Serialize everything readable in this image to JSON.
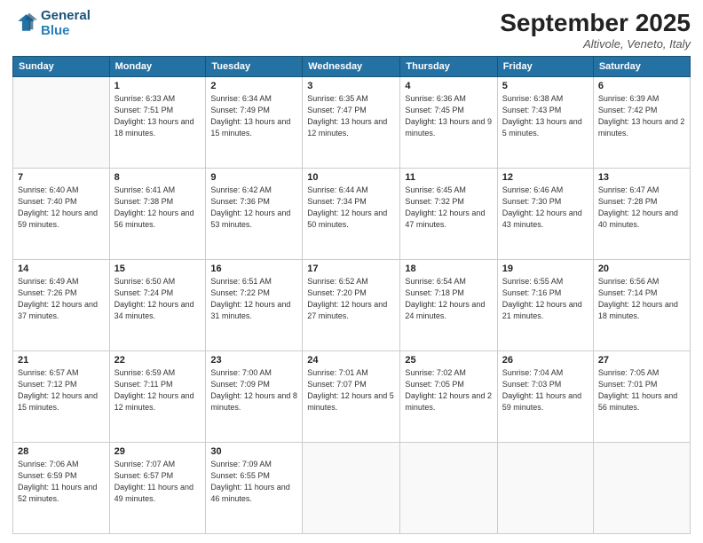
{
  "header": {
    "logo_line1": "General",
    "logo_line2": "Blue",
    "month_title": "September 2025",
    "location": "Altivole, Veneto, Italy"
  },
  "days_of_week": [
    "Sunday",
    "Monday",
    "Tuesday",
    "Wednesday",
    "Thursday",
    "Friday",
    "Saturday"
  ],
  "weeks": [
    [
      {
        "day": "",
        "sunrise": "",
        "sunset": "",
        "daylight": ""
      },
      {
        "day": "1",
        "sunrise": "Sunrise: 6:33 AM",
        "sunset": "Sunset: 7:51 PM",
        "daylight": "Daylight: 13 hours and 18 minutes."
      },
      {
        "day": "2",
        "sunrise": "Sunrise: 6:34 AM",
        "sunset": "Sunset: 7:49 PM",
        "daylight": "Daylight: 13 hours and 15 minutes."
      },
      {
        "day": "3",
        "sunrise": "Sunrise: 6:35 AM",
        "sunset": "Sunset: 7:47 PM",
        "daylight": "Daylight: 13 hours and 12 minutes."
      },
      {
        "day": "4",
        "sunrise": "Sunrise: 6:36 AM",
        "sunset": "Sunset: 7:45 PM",
        "daylight": "Daylight: 13 hours and 9 minutes."
      },
      {
        "day": "5",
        "sunrise": "Sunrise: 6:38 AM",
        "sunset": "Sunset: 7:43 PM",
        "daylight": "Daylight: 13 hours and 5 minutes."
      },
      {
        "day": "6",
        "sunrise": "Sunrise: 6:39 AM",
        "sunset": "Sunset: 7:42 PM",
        "daylight": "Daylight: 13 hours and 2 minutes."
      }
    ],
    [
      {
        "day": "7",
        "sunrise": "Sunrise: 6:40 AM",
        "sunset": "Sunset: 7:40 PM",
        "daylight": "Daylight: 12 hours and 59 minutes."
      },
      {
        "day": "8",
        "sunrise": "Sunrise: 6:41 AM",
        "sunset": "Sunset: 7:38 PM",
        "daylight": "Daylight: 12 hours and 56 minutes."
      },
      {
        "day": "9",
        "sunrise": "Sunrise: 6:42 AM",
        "sunset": "Sunset: 7:36 PM",
        "daylight": "Daylight: 12 hours and 53 minutes."
      },
      {
        "day": "10",
        "sunrise": "Sunrise: 6:44 AM",
        "sunset": "Sunset: 7:34 PM",
        "daylight": "Daylight: 12 hours and 50 minutes."
      },
      {
        "day": "11",
        "sunrise": "Sunrise: 6:45 AM",
        "sunset": "Sunset: 7:32 PM",
        "daylight": "Daylight: 12 hours and 47 minutes."
      },
      {
        "day": "12",
        "sunrise": "Sunrise: 6:46 AM",
        "sunset": "Sunset: 7:30 PM",
        "daylight": "Daylight: 12 hours and 43 minutes."
      },
      {
        "day": "13",
        "sunrise": "Sunrise: 6:47 AM",
        "sunset": "Sunset: 7:28 PM",
        "daylight": "Daylight: 12 hours and 40 minutes."
      }
    ],
    [
      {
        "day": "14",
        "sunrise": "Sunrise: 6:49 AM",
        "sunset": "Sunset: 7:26 PM",
        "daylight": "Daylight: 12 hours and 37 minutes."
      },
      {
        "day": "15",
        "sunrise": "Sunrise: 6:50 AM",
        "sunset": "Sunset: 7:24 PM",
        "daylight": "Daylight: 12 hours and 34 minutes."
      },
      {
        "day": "16",
        "sunrise": "Sunrise: 6:51 AM",
        "sunset": "Sunset: 7:22 PM",
        "daylight": "Daylight: 12 hours and 31 minutes."
      },
      {
        "day": "17",
        "sunrise": "Sunrise: 6:52 AM",
        "sunset": "Sunset: 7:20 PM",
        "daylight": "Daylight: 12 hours and 27 minutes."
      },
      {
        "day": "18",
        "sunrise": "Sunrise: 6:54 AM",
        "sunset": "Sunset: 7:18 PM",
        "daylight": "Daylight: 12 hours and 24 minutes."
      },
      {
        "day": "19",
        "sunrise": "Sunrise: 6:55 AM",
        "sunset": "Sunset: 7:16 PM",
        "daylight": "Daylight: 12 hours and 21 minutes."
      },
      {
        "day": "20",
        "sunrise": "Sunrise: 6:56 AM",
        "sunset": "Sunset: 7:14 PM",
        "daylight": "Daylight: 12 hours and 18 minutes."
      }
    ],
    [
      {
        "day": "21",
        "sunrise": "Sunrise: 6:57 AM",
        "sunset": "Sunset: 7:12 PM",
        "daylight": "Daylight: 12 hours and 15 minutes."
      },
      {
        "day": "22",
        "sunrise": "Sunrise: 6:59 AM",
        "sunset": "Sunset: 7:11 PM",
        "daylight": "Daylight: 12 hours and 12 minutes."
      },
      {
        "day": "23",
        "sunrise": "Sunrise: 7:00 AM",
        "sunset": "Sunset: 7:09 PM",
        "daylight": "Daylight: 12 hours and 8 minutes."
      },
      {
        "day": "24",
        "sunrise": "Sunrise: 7:01 AM",
        "sunset": "Sunset: 7:07 PM",
        "daylight": "Daylight: 12 hours and 5 minutes."
      },
      {
        "day": "25",
        "sunrise": "Sunrise: 7:02 AM",
        "sunset": "Sunset: 7:05 PM",
        "daylight": "Daylight: 12 hours and 2 minutes."
      },
      {
        "day": "26",
        "sunrise": "Sunrise: 7:04 AM",
        "sunset": "Sunset: 7:03 PM",
        "daylight": "Daylight: 11 hours and 59 minutes."
      },
      {
        "day": "27",
        "sunrise": "Sunrise: 7:05 AM",
        "sunset": "Sunset: 7:01 PM",
        "daylight": "Daylight: 11 hours and 56 minutes."
      }
    ],
    [
      {
        "day": "28",
        "sunrise": "Sunrise: 7:06 AM",
        "sunset": "Sunset: 6:59 PM",
        "daylight": "Daylight: 11 hours and 52 minutes."
      },
      {
        "day": "29",
        "sunrise": "Sunrise: 7:07 AM",
        "sunset": "Sunset: 6:57 PM",
        "daylight": "Daylight: 11 hours and 49 minutes."
      },
      {
        "day": "30",
        "sunrise": "Sunrise: 7:09 AM",
        "sunset": "Sunset: 6:55 PM",
        "daylight": "Daylight: 11 hours and 46 minutes."
      },
      {
        "day": "",
        "sunrise": "",
        "sunset": "",
        "daylight": ""
      },
      {
        "day": "",
        "sunrise": "",
        "sunset": "",
        "daylight": ""
      },
      {
        "day": "",
        "sunrise": "",
        "sunset": "",
        "daylight": ""
      },
      {
        "day": "",
        "sunrise": "",
        "sunset": "",
        "daylight": ""
      }
    ]
  ]
}
